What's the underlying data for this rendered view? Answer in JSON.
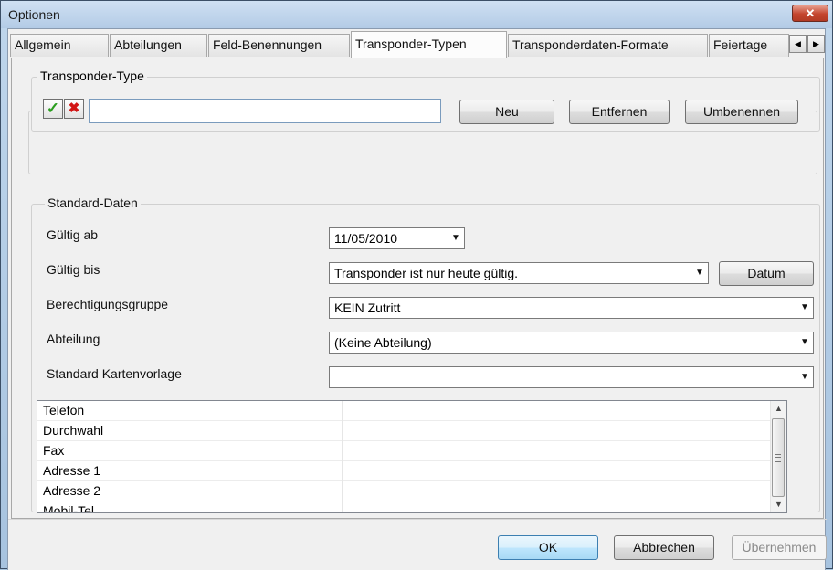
{
  "window": {
    "title": "Optionen",
    "close_glyph": "✕"
  },
  "tabs": [
    {
      "label": "Allgemein",
      "active": false
    },
    {
      "label": "Abteilungen",
      "active": false
    },
    {
      "label": "Feld-Benennungen",
      "active": false
    },
    {
      "label": "Transponder-Typen",
      "active": true
    },
    {
      "label": "Transponderdaten-Formate",
      "active": false
    },
    {
      "label": "Feiertage",
      "active": false
    }
  ],
  "transponder_type": {
    "legend": "Transponder-Type",
    "name_value": "",
    "buttons": {
      "new": "Neu",
      "remove": "Entfernen",
      "rename": "Umbenennen"
    },
    "icons": {
      "accept": "check-icon",
      "reject": "x-icon"
    }
  },
  "standard": {
    "legend": "Standard-Daten",
    "valid_from": {
      "label": "Gültig ab",
      "value": "11/05/2010"
    },
    "valid_until": {
      "label": "Gültig bis",
      "value": "Transponder ist nur heute gültig.",
      "button": "Datum"
    },
    "auth_group": {
      "label": "Berechtigungsgruppe",
      "value": "KEIN Zutritt"
    },
    "department": {
      "label": "Abteilung",
      "value": "(Keine Abteilung)"
    },
    "card_template": {
      "label": "Standard Kartenvorlage",
      "value": ""
    }
  },
  "fields": [
    "Telefon",
    "Durchwahl",
    "Fax",
    "Adresse 1",
    "Adresse 2",
    "Mobil-Tel."
  ],
  "footer": {
    "ok": "OK",
    "cancel": "Abbrechen",
    "apply": "Übernehmen"
  },
  "colors": {
    "accent": "#3c7fb1",
    "check": "#2a9d1e",
    "close": "#c4452e"
  }
}
